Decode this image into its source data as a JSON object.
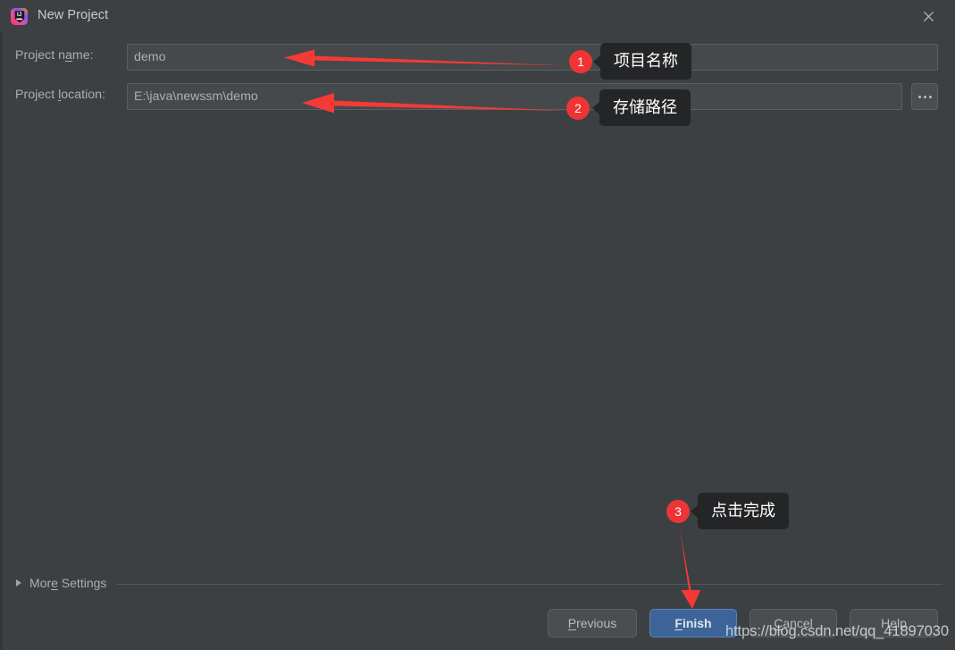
{
  "window": {
    "title": "New Project",
    "app_icon": "intellij-idea-logo",
    "close_icon": "close-icon",
    "background_color": "#3c4043"
  },
  "form": {
    "fields": [
      {
        "label_before": "Project n",
        "label_mnemonic": "a",
        "label_after": "me:",
        "label_full": "Project name:",
        "value": "demo",
        "placeholder": ""
      },
      {
        "label_before": "Project ",
        "label_mnemonic": "l",
        "label_after": "ocation:",
        "label_full": "Project location:",
        "value": "E:\\java\\newssm\\demo",
        "placeholder": ""
      }
    ],
    "browse_button": {
      "label": "...",
      "icon": "ellipsis-icon"
    }
  },
  "more_settings": {
    "label_before": "Mor",
    "label_mnemonic": "e",
    "label_after": " Settings",
    "label_full": "More Settings",
    "expanded": false,
    "expand_icon": "chevron-right-icon"
  },
  "footer": {
    "buttons": [
      {
        "name": "previous",
        "before": "",
        "mnemonic": "P",
        "after": "revious",
        "label_full": "Previous",
        "primary": false
      },
      {
        "name": "finish",
        "before": "",
        "mnemonic": "F",
        "after": "inish",
        "label_full": "Finish",
        "primary": true
      },
      {
        "name": "cancel",
        "before": "",
        "mnemonic": "C",
        "after": "ancel",
        "label_full": "Cancel",
        "primary": false
      },
      {
        "name": "help",
        "before": "H",
        "mnemonic": "e",
        "after": "lp",
        "label_full": "Help",
        "primary": false
      }
    ],
    "primary_button_color": "#3c6498"
  },
  "annotations": {
    "accent_color": "#ee3434",
    "callout_bg": "#242527",
    "items": [
      {
        "number": "1",
        "text": "项目名称",
        "target": "project-name-input",
        "arrow": "left"
      },
      {
        "number": "2",
        "text": "存储路径",
        "target": "project-location-input",
        "arrow": "left"
      },
      {
        "number": "3",
        "text": "点击完成",
        "target": "finish-button",
        "arrow": "down"
      }
    ]
  },
  "watermark": {
    "text": "https://blog.csdn.net/qq_41897030"
  }
}
